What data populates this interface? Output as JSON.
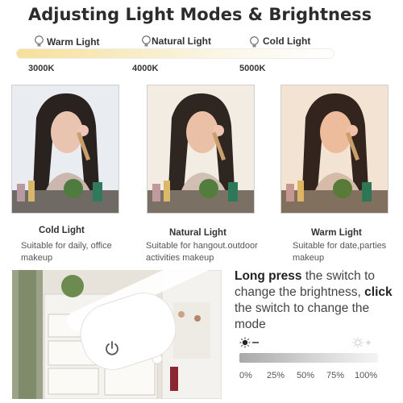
{
  "title": "Adjusting Light Modes & Brightness",
  "temperature_scale": {
    "modes": [
      {
        "label": "Warm Light",
        "kelvin": "3000K"
      },
      {
        "label": "Natural Light",
        "kelvin": "4000K"
      },
      {
        "label": "Cold Light",
        "kelvin": "5000K"
      }
    ]
  },
  "photos": [
    {
      "title": "Cold Light",
      "description": "Suitable for daily, office makeup",
      "tint": "#e9edf1"
    },
    {
      "title": "Natural Light",
      "description": "Suitable for hangout.outdoor activities makeup",
      "tint": "#f2ece2"
    },
    {
      "title": "Warm Light",
      "description": "Suitable for date,parties makeup",
      "tint": "#f3e3d2"
    }
  ],
  "instructions": {
    "long_press_bold": "Long press",
    "long_press_rest": " the switch to change the brightness,",
    "click_bold": "click",
    "click_rest": " the switch to change the mode"
  },
  "brightness": {
    "levels": [
      "0%",
      "25%",
      "50%",
      "75%",
      "100%"
    ]
  },
  "colors": {
    "warm": "#f6df9a",
    "title": "#2c2c2c",
    "text": "#444444"
  }
}
